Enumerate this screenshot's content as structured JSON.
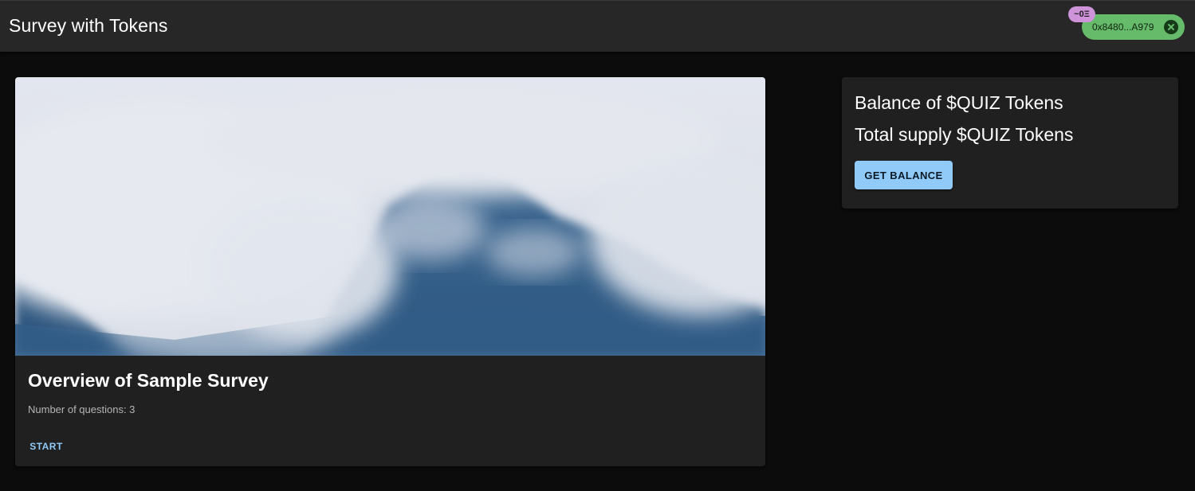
{
  "header": {
    "title": "Survey with Tokens",
    "eth_badge": "~0Ξ",
    "wallet_address": "0x8480...A979",
    "close_icon": "close-circle-icon",
    "chip_color": "#66bb6a",
    "badge_color": "#ce93d8"
  },
  "survey_card": {
    "image_description": "misty-mountain-image",
    "title": "Overview of Sample Survey",
    "question_count": "Number of questions: 3",
    "start_label": "START"
  },
  "balance_card": {
    "balance_label": "Balance of $QUIZ Tokens",
    "supply_label": "Total supply $QUIZ Tokens",
    "button_label": "GET BALANCE",
    "button_color": "#90caf9"
  }
}
